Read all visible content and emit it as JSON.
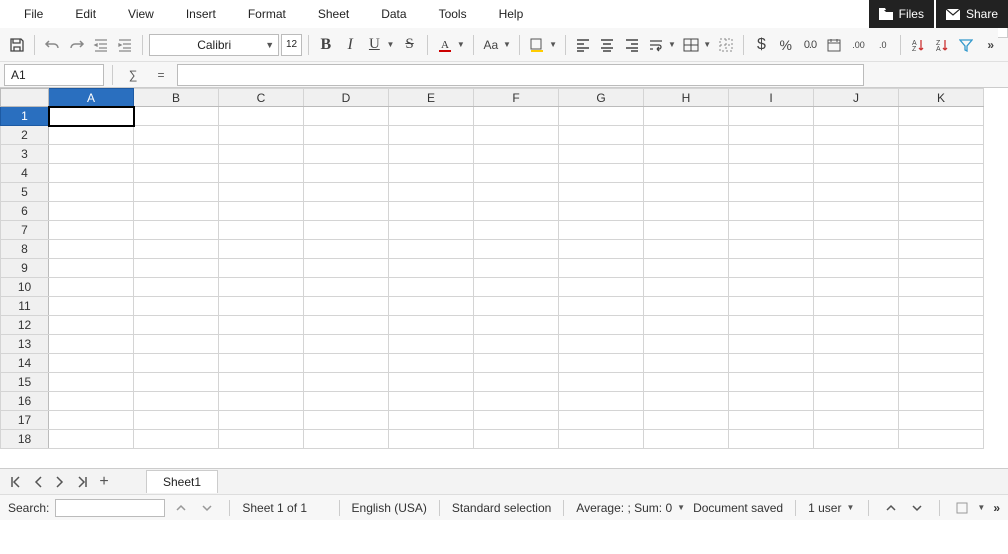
{
  "menu": [
    "File",
    "Edit",
    "View",
    "Insert",
    "Format",
    "Sheet",
    "Data",
    "Tools",
    "Help"
  ],
  "top_buttons": {
    "files": "Files",
    "share": "Share"
  },
  "toolbar": {
    "font_name": "Calibri",
    "font_size": "12",
    "bold": "B",
    "italic": "I",
    "underline": "U",
    "strike": "S",
    "case": "Aa",
    "currency": "$",
    "percent": "%"
  },
  "formula": {
    "cell_ref": "A1",
    "sigma": "∑",
    "equals": "=",
    "value": ""
  },
  "grid": {
    "columns": [
      "A",
      "B",
      "C",
      "D",
      "E",
      "F",
      "G",
      "H",
      "I",
      "J",
      "K"
    ],
    "rows": [
      "1",
      "2",
      "3",
      "4",
      "5",
      "6",
      "7",
      "8",
      "9",
      "10",
      "11",
      "12",
      "13",
      "14",
      "15",
      "16",
      "17",
      "18"
    ],
    "active_col": 0,
    "active_row": 0
  },
  "sheet_tab": "Sheet1",
  "status": {
    "search_label": "Search:",
    "sheet_count": "Sheet 1 of 1",
    "language": "English (USA)",
    "selection_mode": "Standard selection",
    "aggregate": "Average: ; Sum: 0",
    "save_state": "Document saved",
    "users": "1 user",
    "more": "»"
  }
}
